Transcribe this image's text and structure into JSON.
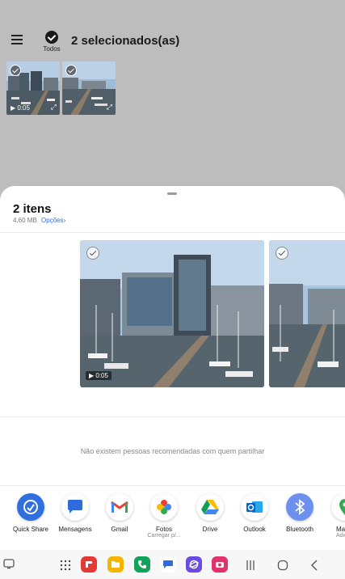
{
  "header": {
    "todos_label": "Todos",
    "selected_title": "2 selecionados(as)"
  },
  "thumbnails": [
    {
      "duration": "0:05"
    },
    {
      "duration": ""
    }
  ],
  "sheet": {
    "items_title": "2 itens",
    "size": "4,60 MB",
    "options_label": "Opções",
    "options_chevron": "›",
    "preview_duration": "0:05",
    "no_people_text": "Não existem pessoas recomendadas com quem partilhar"
  },
  "share_apps": [
    {
      "label": "Quick Share",
      "sub": "",
      "icon": "quick-share-icon",
      "color": "#2f6fe0"
    },
    {
      "label": "Mensagens",
      "sub": "",
      "icon": "messages-icon",
      "color": "#2d6bdf"
    },
    {
      "label": "Gmail",
      "sub": "",
      "icon": "gmail-icon",
      "color": "#ea4335"
    },
    {
      "label": "Fotos",
      "sub": "Carregar p/...",
      "icon": "photos-icon",
      "color": "#fbbc04"
    },
    {
      "label": "Drive",
      "sub": "",
      "icon": "drive-icon",
      "color": "#0f9d58"
    },
    {
      "label": "Outlook",
      "sub": "",
      "icon": "outlook-icon",
      "color": "#0a64c8"
    },
    {
      "label": "Bluetooth",
      "sub": "",
      "icon": "bluetooth-icon",
      "color": "#6d8ff0"
    },
    {
      "label": "Ma",
      "sub": "Adicio",
      "icon": "maps-icon",
      "color": "#34a853"
    }
  ],
  "dock": {
    "apps": [
      {
        "icon": "flipboard-icon",
        "color": "#e53935"
      },
      {
        "icon": "files-icon",
        "color": "#f4b400"
      },
      {
        "icon": "phone-icon",
        "color": "#12a35a"
      },
      {
        "icon": "messages-icon",
        "color": "#2d6bdf"
      },
      {
        "icon": "internet-icon",
        "color": "#6a4de0"
      },
      {
        "icon": "camera-icon",
        "color": "#e0336a"
      }
    ]
  }
}
